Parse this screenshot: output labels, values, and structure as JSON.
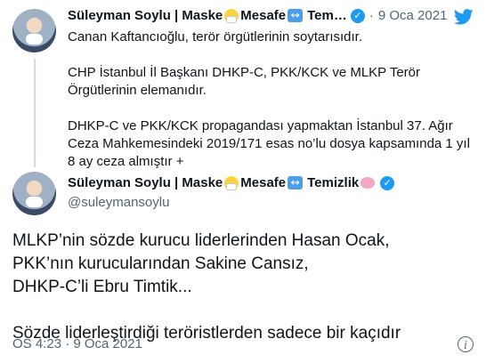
{
  "reply_tweet": {
    "author_name": "Süleyman Soylu | Maske",
    "name_part2": "Mesafe",
    "name_part3": "Tem…",
    "separator": "·",
    "date": "9 Oca 2021",
    "text": "Canan Kaftancıoğlu, terör örgütlerinin soytarısıdır.\n\nCHP İstanbul İl Başkanı DHKP-C, PKK/KCK ve MLKP Terör\nÖrgütlerinin elemanıdır.\n\nDHKP-C ve PKK/KCK propagandası yapmaktan İstanbul 37. Ağır\nCeza Mahkemesindeki 2019/171 esas no’lu dosya kapsamında 1 yıl\n8 ay ceza almıştır +"
  },
  "main_tweet": {
    "author_name": "Süleyman Soylu | Maske",
    "name_part2": "Mesafe",
    "name_part3": "Temizlik",
    "handle": "@suleymansoylu",
    "text": "MLKP’nin sözde kurucu liderlerinden Hasan Ocak,\nPKK’nın kurucularından Sakine Cansız,\nDHKP-C’li Ebru Timtik...\n\nSözde liderleştirdiği teröristlerden sadece bir kaçıdır",
    "timestamp": "ÖS 4:23 · 9 Oca 2021"
  },
  "icons": {
    "verified": "verified-badge-icon",
    "bird": "twitter-bird-icon",
    "info": "info-icon"
  },
  "colors": {
    "verified": "#1d9bf0",
    "meta": "#536471",
    "text": "#0f1419"
  }
}
